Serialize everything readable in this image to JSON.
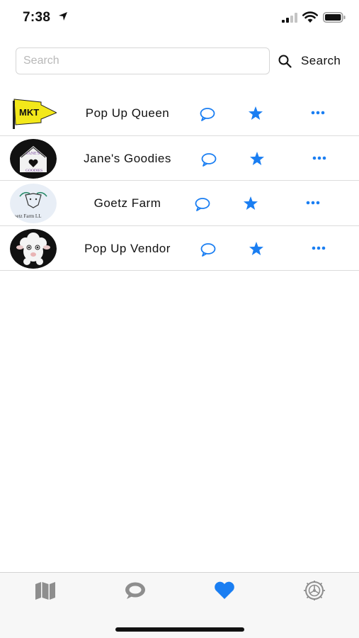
{
  "status_bar": {
    "time": "7:38",
    "icons": [
      "location-arrow-icon",
      "cellular-signal-icon",
      "wifi-icon",
      "battery-icon"
    ]
  },
  "search": {
    "placeholder": "Search",
    "value": "",
    "button_label": "Search",
    "button_icon": "magnifier-icon"
  },
  "vendors": [
    {
      "name": "Pop Up Queen",
      "logo": "MKT",
      "logo_icon": "mkt-flag-logo"
    },
    {
      "name": "Jane's Goodies",
      "logo": "JANE'S GOODIES",
      "logo_icon": "house-heart-logo"
    },
    {
      "name": "Goetz Farm",
      "logo": "Goetz Farm LLC",
      "logo_icon": "goat-logo"
    },
    {
      "name": "Pop Up Vendor",
      "logo": "",
      "logo_icon": "sheep-logo"
    }
  ],
  "row_actions": {
    "chat_icon": "chat-bubble-icon",
    "favorite_icon": "star-icon",
    "more_icon": "ellipsis-icon"
  },
  "tab_bar": {
    "tabs": [
      {
        "icon": "map-icon",
        "active": false
      },
      {
        "icon": "chat-bubble-icon",
        "active": false
      },
      {
        "icon": "heart-icon",
        "active": true
      },
      {
        "icon": "settings-wheel-icon",
        "active": false
      }
    ]
  },
  "colors": {
    "accent": "#1a7ef2",
    "inactive_tab": "#8e8e8e",
    "divider": "#dcdcdc"
  }
}
